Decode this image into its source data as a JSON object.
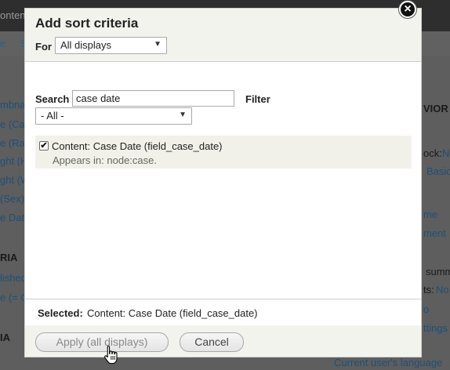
{
  "background": {
    "topbar_text": "ontent",
    "tabs": [
      "e",
      "S"
    ],
    "left_items": [
      "mbna",
      "e (Cas",
      "e (Rac",
      "ght (H",
      "ght (W",
      "(Sex)",
      "e Dat"
    ],
    "section1": "RIA",
    "section1_items": [
      "lished",
      "e (= C"
    ],
    "section2": "IA",
    "right_items": {
      "vior": "VIOR",
      "ock": "ock:",
      "ock_val": "No",
      "basic": "Basic",
      "me": "me",
      "ment": "ment",
      "summ": "summ",
      "ts": "ts:",
      "ts_val": "No",
      "o": "o",
      "ettings": "ttings",
      "current_user_lang": "Current user's language"
    }
  },
  "dialog": {
    "title": "Add sort criteria",
    "for_label": "For",
    "for_value": "All displays",
    "close_glyph": "×",
    "search_label": "Search",
    "search_value": "case date",
    "filter_label": "Filter",
    "filter_value": "- All -",
    "results": [
      {
        "checked": true,
        "title": "Content: Case Date (field_case_date)",
        "appears_in": "Appears in: node:case."
      }
    ],
    "selected_label": "Selected:",
    "selected_value": "Content: Case Date (field_case_date)",
    "apply_button": "Apply (all displays)",
    "cancel_button": "Cancel"
  },
  "colors": {
    "overlay": "#5e5e5e",
    "dialog_header": "#f3f3ee",
    "result_row": "#f1f1e9",
    "link_dim": "#1d4f7a"
  }
}
